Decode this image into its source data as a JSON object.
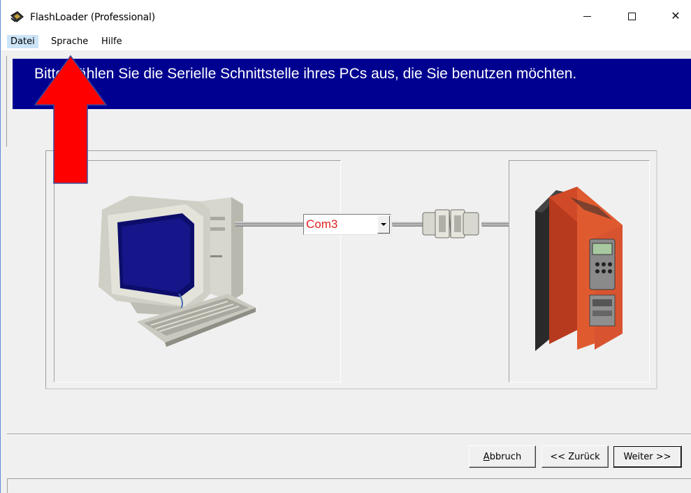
{
  "window": {
    "title": "FlashLoader  (Professional)",
    "icon": "flashloader-chip-icon",
    "controls": {
      "minimize": "minimize-icon",
      "maximize": "maximize-icon",
      "close": "close-icon",
      "close_glyph": "✕"
    }
  },
  "menu": {
    "items": [
      {
        "label": "Datei"
      },
      {
        "label": "Sprache"
      },
      {
        "label": "Hilfe"
      }
    ]
  },
  "banner": {
    "text": "Bitte wählen Sie die Serielle Schnittstelle ihres PCs aus, die Sie benutzen möchten.",
    "background": "#000090",
    "color": "#ffffff"
  },
  "port_select": {
    "value": "Com3",
    "text_color": "#e02020"
  },
  "annotation": {
    "arrow_color": "#ff0000",
    "arrow_icon": "red-up-arrow-icon"
  },
  "buttons": {
    "cancel": "Abbruch",
    "back": "<< Zurück",
    "next": "Weiter >>"
  },
  "colors": {
    "window_bg": "#f0f0f0",
    "menu_highlight": "#cce4f7"
  }
}
